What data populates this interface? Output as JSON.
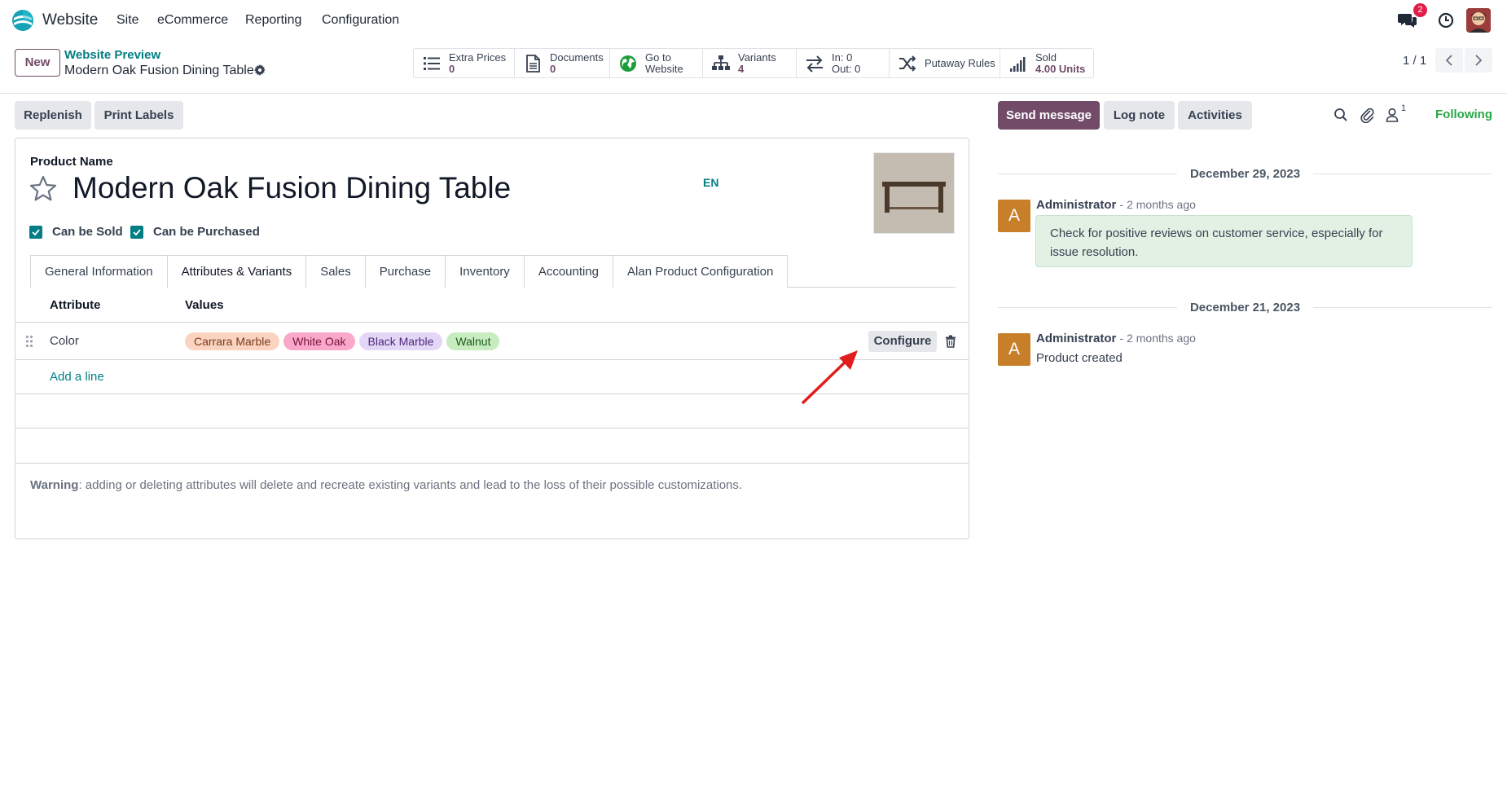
{
  "navbar": {
    "app_name": "Website",
    "menu": [
      "Site",
      "eCommerce",
      "Reporting",
      "Configuration"
    ],
    "message_count": "2"
  },
  "control": {
    "new_label": "New",
    "breadcrumb_parent": "Website Preview",
    "breadcrumb_current": "Modern Oak Fusion Dining Table",
    "pager": "1 / 1"
  },
  "smart_buttons": [
    {
      "icon": "list-icon",
      "label": "Extra Prices",
      "value": "0"
    },
    {
      "icon": "document-icon",
      "label": "Documents",
      "value": "0"
    },
    {
      "icon": "globe-icon",
      "label": "Go to",
      "value": "Website"
    },
    {
      "icon": "sitemap-icon",
      "label": "Variants",
      "value": "4"
    },
    {
      "icon": "exchange-icon",
      "label": "In: 0",
      "value": "Out: 0"
    },
    {
      "icon": "random-icon",
      "label": "Putaway Rules",
      "value": ""
    },
    {
      "icon": "bar-chart-icon",
      "label": "Sold",
      "value": "4.00 Units"
    }
  ],
  "actions": {
    "replenish": "Replenish",
    "print_labels": "Print Labels"
  },
  "form": {
    "product_name_label": "Product Name",
    "product_name": "Modern Oak Fusion Dining Table",
    "lang": "EN",
    "can_be_sold": "Can be Sold",
    "can_be_purchased": "Can be Purchased",
    "tabs": [
      "General Information",
      "Attributes & Variants",
      "Sales",
      "Purchase",
      "Inventory",
      "Accounting",
      "Alan Product Configuration"
    ],
    "active_tab": "Attributes & Variants",
    "table": {
      "col_attribute": "Attribute",
      "col_values": "Values",
      "row_attribute": "Color",
      "values": [
        {
          "label": "Carrara Marble",
          "color": "#fad4c0"
        },
        {
          "label": "White Oak",
          "color": "#f9a8c9"
        },
        {
          "label": "Black Marble",
          "color": "#e4d6f7"
        },
        {
          "label": "Walnut",
          "color": "#c7ecc0"
        }
      ],
      "configure": "Configure",
      "add_line": "Add a line"
    },
    "warning_bold": "Warning",
    "warning_text": ": adding or deleting attributes will delete and recreate existing variants and lead to the loss of their possible customizations."
  },
  "chatter": {
    "send_message": "Send message",
    "log_note": "Log note",
    "activities": "Activities",
    "followers_count": "1",
    "following": "Following",
    "messages": [
      {
        "date": "December 29, 2023",
        "author": "Administrator",
        "time": "- 2 months ago",
        "initial": "A",
        "body": "Check for positive reviews on customer service, especially for issue resolution."
      },
      {
        "date": "December 21, 2023",
        "author": "Administrator",
        "time": "- 2 months ago",
        "initial": "A",
        "body": "Product created"
      }
    ]
  },
  "colors": {
    "brand": "#714b67",
    "teal": "#017e84",
    "annotation_arrow": "#e11d1d"
  }
}
